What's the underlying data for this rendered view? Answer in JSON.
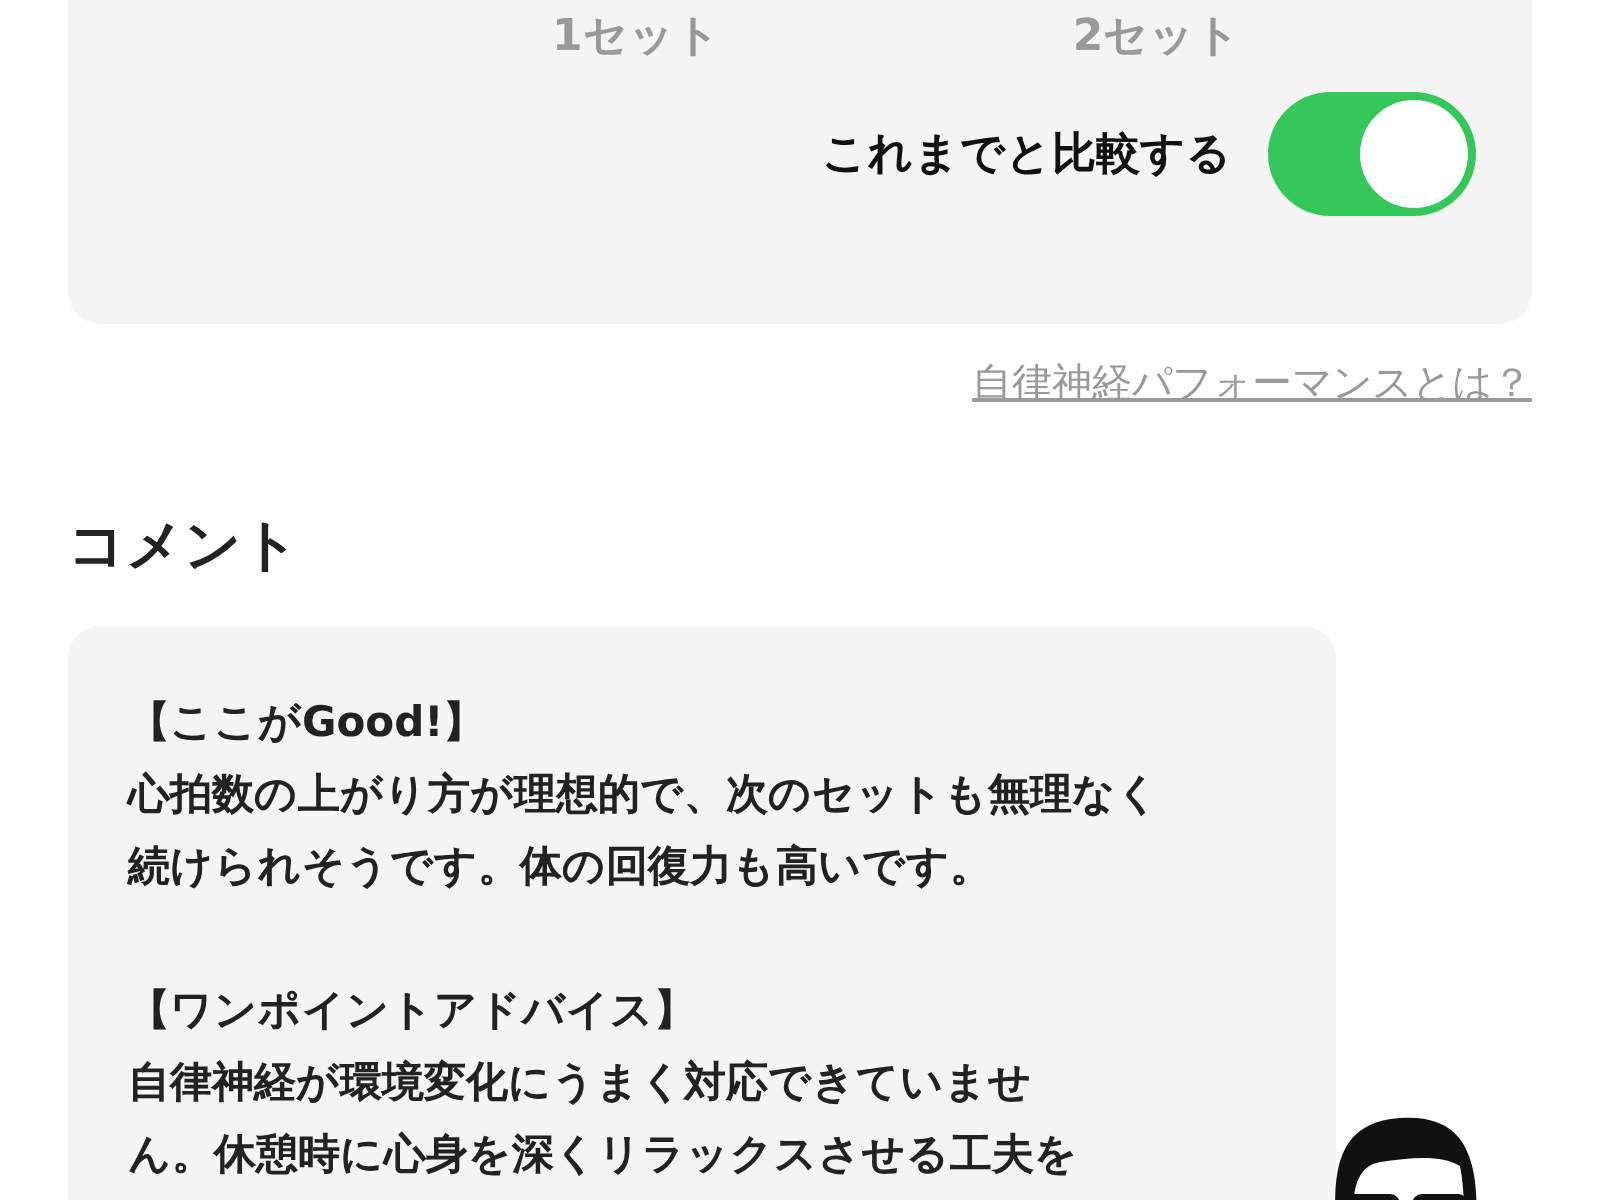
{
  "summary_card": {
    "set_labels": [
      "1セット",
      "2セット"
    ],
    "compare": {
      "label": "これまでと比較する",
      "on": true
    }
  },
  "help_link": "自律神経パフォーマンスとは？",
  "comment": {
    "heading": "コメント",
    "sections": [
      {
        "title": "【ここがGood!】",
        "lines": [
          "心拍数の上がり方が理想的で、次のセットも無理なく",
          "続けられそうです。体の回復力も高いです。"
        ]
      },
      {
        "title": "【ワンポイントアドバイス】",
        "lines": [
          "自律神経が環境変化にうまく対応できていませ",
          "ん。休憩時に心身を深くリラックスさせる工夫を"
        ]
      }
    ]
  }
}
